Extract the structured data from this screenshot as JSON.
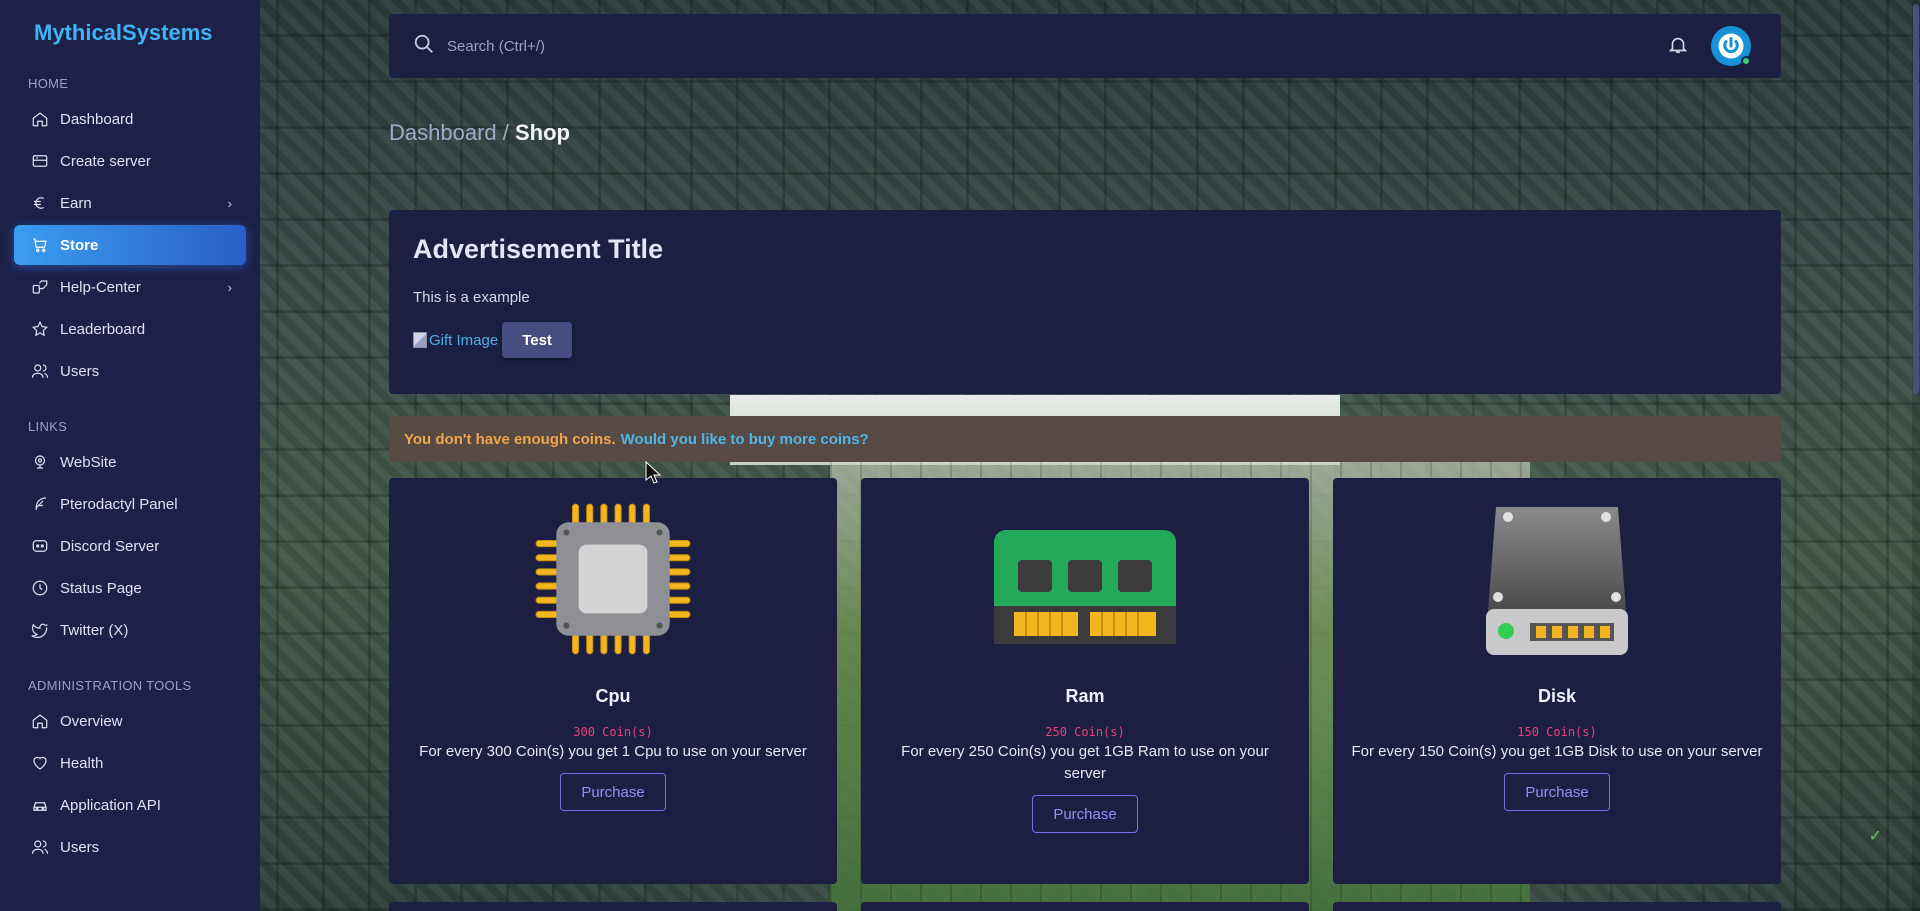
{
  "brand": "MythicalSystems",
  "sidebar": {
    "sections": [
      {
        "title": "HOME",
        "items": [
          {
            "label": "Dashboard",
            "icon": "home-icon"
          },
          {
            "label": "Create server",
            "icon": "server-icon"
          },
          {
            "label": "Earn",
            "icon": "euro-icon",
            "has_submenu": true
          },
          {
            "label": "Store",
            "icon": "cart-icon",
            "active": true
          },
          {
            "label": "Help-Center",
            "icon": "help-icon",
            "has_submenu": true
          },
          {
            "label": "Leaderboard",
            "icon": "star-icon"
          },
          {
            "label": "Users",
            "icon": "users-icon"
          }
        ]
      },
      {
        "title": "LINKS",
        "items": [
          {
            "label": "WebSite",
            "icon": "globe-icon"
          },
          {
            "label": "Pterodactyl Panel",
            "icon": "feather-icon"
          },
          {
            "label": "Discord Server",
            "icon": "discord-icon"
          },
          {
            "label": "Status Page",
            "icon": "clock-icon"
          },
          {
            "label": "Twitter (X)",
            "icon": "twitter-icon"
          }
        ]
      },
      {
        "title": "ADMINISTRATION TOOLS",
        "items": [
          {
            "label": "Overview",
            "icon": "home-icon"
          },
          {
            "label": "Health",
            "icon": "heart-icon"
          },
          {
            "label": "Application API",
            "icon": "car-icon"
          },
          {
            "label": "Users",
            "icon": "users-icon"
          }
        ]
      }
    ]
  },
  "topbar": {
    "search_placeholder": "Search (Ctrl+/)"
  },
  "breadcrumb": {
    "parent": "Dashboard /",
    "current": "Shop"
  },
  "ad": {
    "title": "Advertisement Title",
    "text": "This is a example",
    "image_alt": "Gift Image",
    "button_label": "Test"
  },
  "alert": {
    "text": "You don't have enough coins.",
    "link": "Would you like to buy more coins?"
  },
  "products": [
    {
      "name": "Cpu",
      "price": "300 Coin(s)",
      "description": "For every 300 Coin(s) you get 1 Cpu to use on your server",
      "button": "Purchase"
    },
    {
      "name": "Ram",
      "price": "250 Coin(s)",
      "description": "For every 250 Coin(s) you get 1GB Ram to use on your server",
      "button": "Purchase"
    },
    {
      "name": "Disk",
      "price": "150 Coin(s)",
      "description": "For every 150 Coin(s) you get 1GB Disk to use on your server",
      "button": "Purchase"
    }
  ],
  "colors": {
    "brand": "#3fb4f5",
    "sidebar_bg": "#1e2147",
    "card_bg": "#1c1f42",
    "active_gradient_start": "#3a9df0",
    "price": "#e8427a",
    "alert_text": "#f0a64a",
    "alert_link": "#4fb6e8",
    "purchase_border": "#7a6ce6"
  }
}
